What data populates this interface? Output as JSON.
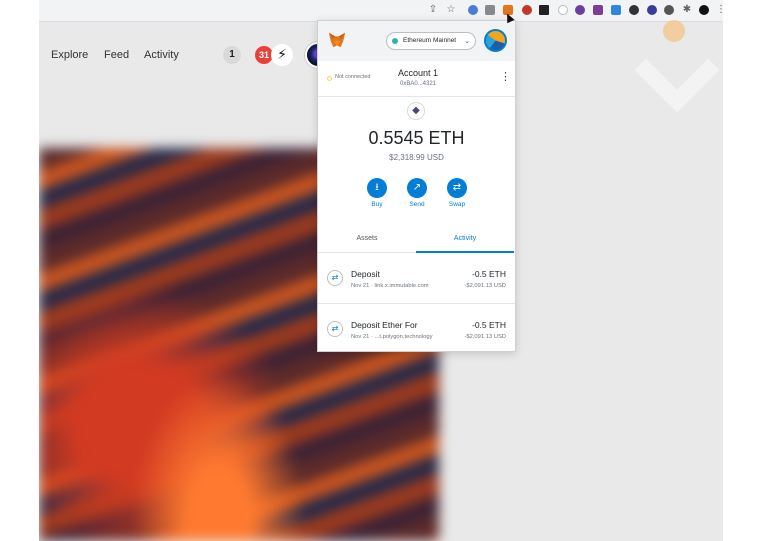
{
  "toolbar": {
    "icons": [
      "share-icon",
      "star-icon",
      "extensions-icon",
      "more-icon"
    ]
  },
  "site_nav": {
    "explore": "Explore",
    "feed": "Feed",
    "activity": "Activity",
    "activity_count": "1",
    "notifications_count": "31",
    "bolt_icon": "⚡"
  },
  "metamask": {
    "network": "Ethereum Mainnet",
    "connection_status": "Not connected",
    "account_name": "Account 1",
    "account_address": "0xBA0...4321",
    "balance": "0.5545 ETH",
    "balance_usd": "$2,318.99 USD",
    "actions": [
      {
        "label": "Buy",
        "icon": "download-icon"
      },
      {
        "label": "Send",
        "icon": "arrow-up-right-icon"
      },
      {
        "label": "Swap",
        "icon": "swap-icon"
      }
    ],
    "tabs": [
      {
        "label": "Assets",
        "active": false
      },
      {
        "label": "Activity",
        "active": true
      }
    ],
    "transactions": [
      {
        "title": "Deposit",
        "sub": "Nov 21 · link.x.immutable.com",
        "amount": "-0.5 ETH",
        "usd": "-$2,091.13 USD"
      },
      {
        "title": "Deposit Ether For",
        "sub": "Nov 21 · ...t.polygon.technology",
        "amount": "-0.5 ETH",
        "usd": "-$2,091.13 USD"
      }
    ],
    "colors": {
      "primary": "#037dd6",
      "network_dot": "#29b6af"
    }
  }
}
